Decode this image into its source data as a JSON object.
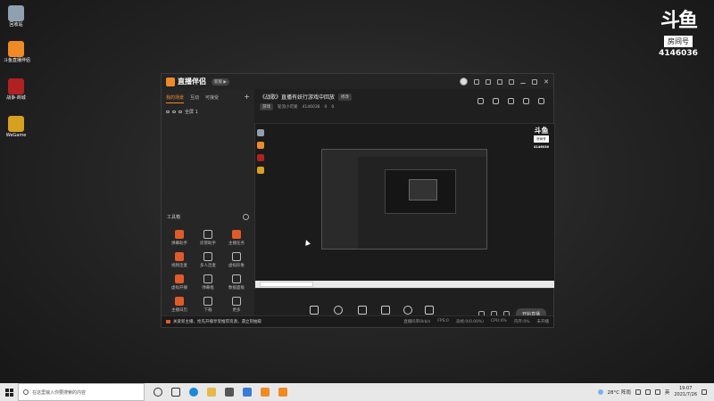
{
  "desktop": {
    "icons": [
      {
        "label": "回收站",
        "color": "#9ab"
      },
      {
        "label": "斗鱼直播伴侣",
        "color": "#f08a24"
      },
      {
        "label": "战争·商城",
        "color": "#b22"
      },
      {
        "label": "WeGame",
        "color": "#d8a020"
      }
    ]
  },
  "watermark": {
    "logo": "斗鱼",
    "room_label": "房间号",
    "room_number": "4146036"
  },
  "app": {
    "brand": "直播伴侣",
    "version_badge": "新版 ▶",
    "left": {
      "tabs": [
        "我的场景",
        "互动",
        "可接受"
      ],
      "add_label": "+",
      "scene": "全屏 1",
      "tools_title": "工具箱",
      "tools": [
        "弹幕助手",
        "房管助手",
        "主播任务",
        "视频连麦",
        "多人连麦",
        "虚拟形象",
        "虚拟开播",
        "弹幕框",
        "数据面板",
        "主播日历",
        "下载",
        "更多"
      ]
    },
    "header": {
      "room_title": "《战歌》直播有妖行游戏中回放",
      "edit_label": "修改",
      "category": "游戏",
      "streamer": "轮流小可爱",
      "room_id": "4146036",
      "likes": "0",
      "viewers": "0"
    },
    "preview_watermark": {
      "logo": "斗鱼",
      "room_label": "房间号",
      "room_number": "4146036"
    },
    "controls": [
      {
        "label": "直播屏幕",
        "icon": "monitor-icon"
      },
      {
        "label": "摄像头",
        "icon": "camera-icon"
      },
      {
        "label": "手机投屏",
        "icon": "phone-cast-icon"
      },
      {
        "label": "多媒体",
        "icon": "media-icon"
      },
      {
        "label": "麦克风",
        "icon": "mic-icon"
      },
      {
        "label": "扬声器",
        "icon": "speaker-icon"
      }
    ],
    "live_button": "开始直播",
    "status": {
      "notice": "关爱新主播，抢先开播享受推荐资源，遇立刻抽取",
      "stats": [
        "直播码率0kb/s",
        "FPS:0",
        "丢帧:0(0.00%)",
        "CPU:0%",
        "内存:0%",
        "未开播"
      ]
    }
  },
  "taskbar": {
    "search_placeholder": "在这里输入你要搜索的内容",
    "weather": "28°C 阵雨",
    "lang": "英",
    "time": "19:07",
    "date": "2021/7/26"
  }
}
